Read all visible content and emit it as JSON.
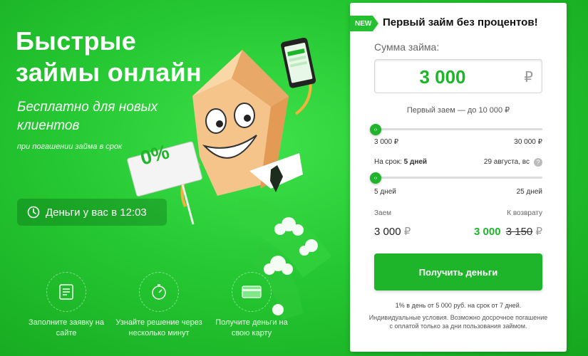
{
  "hero": {
    "title": "Быстрые займы онлайн",
    "subtitle": "Бесплатно для новых клиентов",
    "note": "при погашении займа в срок",
    "sign_text": "0%",
    "clock_text": "Деньги у вас в 12:03"
  },
  "steps": [
    {
      "icon": "form-icon",
      "label": "Заполните заявку на сайте"
    },
    {
      "icon": "timer-icon",
      "label": "Узнайте решение через несколько минут"
    },
    {
      "icon": "card-icon",
      "label": "Получите деньги на свою карту"
    }
  ],
  "card": {
    "badge": "NEW",
    "title": "Первый займ без процентов!",
    "sum_label": "Сумма займа:",
    "sum_value": "3 000",
    "currency": "₽",
    "first_loan_note": "Первый заем — до 10 000 ₽",
    "amount_slider": {
      "min_label": "3 000 ₽",
      "max_label": "30 000 ₽",
      "position": 0
    },
    "term_label": "На срок:",
    "term_value": "5 дней",
    "term_date": "29 августа, вс",
    "help": "?",
    "term_slider": {
      "min_label": "5 дней",
      "max_label": "25 дней",
      "position": 0
    },
    "loan_label": "Заем",
    "return_label": "К возврату",
    "loan_value": "3 000",
    "return_value_new": "3 000",
    "return_value_old": "3 150",
    "cta_label": "Получить деньги",
    "rate_note": "1% в день от 5 000 руб. на срок от 7 дней.",
    "terms_note": "Индивидуальные условия. Возможно досрочное погашение с оплатой только за дни пользования займом."
  },
  "colors": {
    "accent": "#1fb52b",
    "background": "#25c832"
  }
}
